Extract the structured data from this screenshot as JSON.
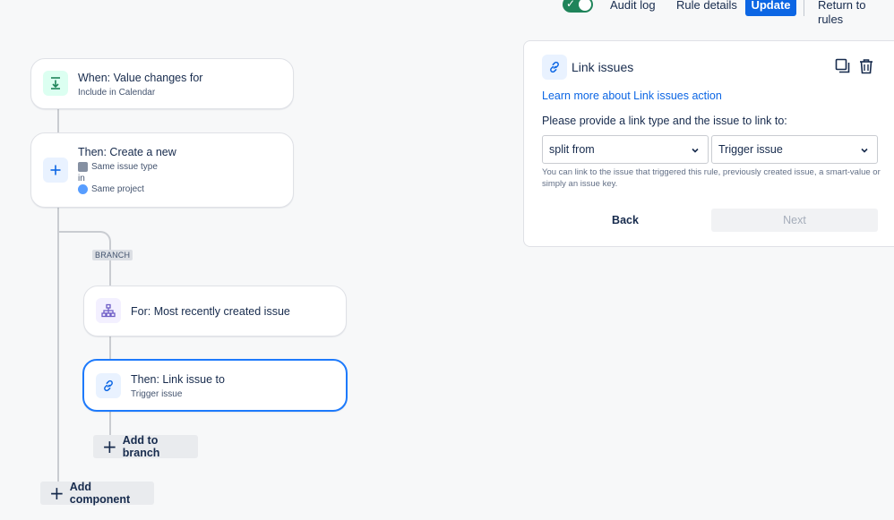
{
  "header": {
    "audit_log": "Audit log",
    "rule_details": "Rule details",
    "update": "Update",
    "return_to_rules": "Return to rules",
    "toggle_check": "✓"
  },
  "flow": {
    "trigger": {
      "title": "When: Value changes for",
      "subtitle": "Include in Calendar",
      "icon": "download-arrow-icon"
    },
    "create": {
      "title": "Then: Create a new",
      "issue_type": "Same issue type",
      "in": "in",
      "project": "Same project",
      "icon": "plus-icon"
    },
    "branch_label": "BRANCH",
    "branch_for": {
      "title": "For: Most recently created issue",
      "icon": "hierarchy-icon"
    },
    "link_action": {
      "title": "Then: Link issue to",
      "subtitle": "Trigger issue",
      "icon": "link-icon"
    },
    "add_to_branch": "Add to branch",
    "add_component": "Add component",
    "plus_glyph": "+"
  },
  "panel": {
    "title": "Link issues",
    "learn_more": "Learn more about Link issues action",
    "prompt": "Please provide a link type and the issue to link to:",
    "link_type_value": "split from",
    "issue_value": "Trigger issue",
    "helper": "You can link to the issue that triggered this rule, previously created issue, a smart-value or simply an issue key.",
    "back": "Back",
    "next": "Next"
  },
  "colors": {
    "accent": "#0c66e4",
    "toggle_on": "#1f845a",
    "selected_border": "#1d7afc"
  }
}
